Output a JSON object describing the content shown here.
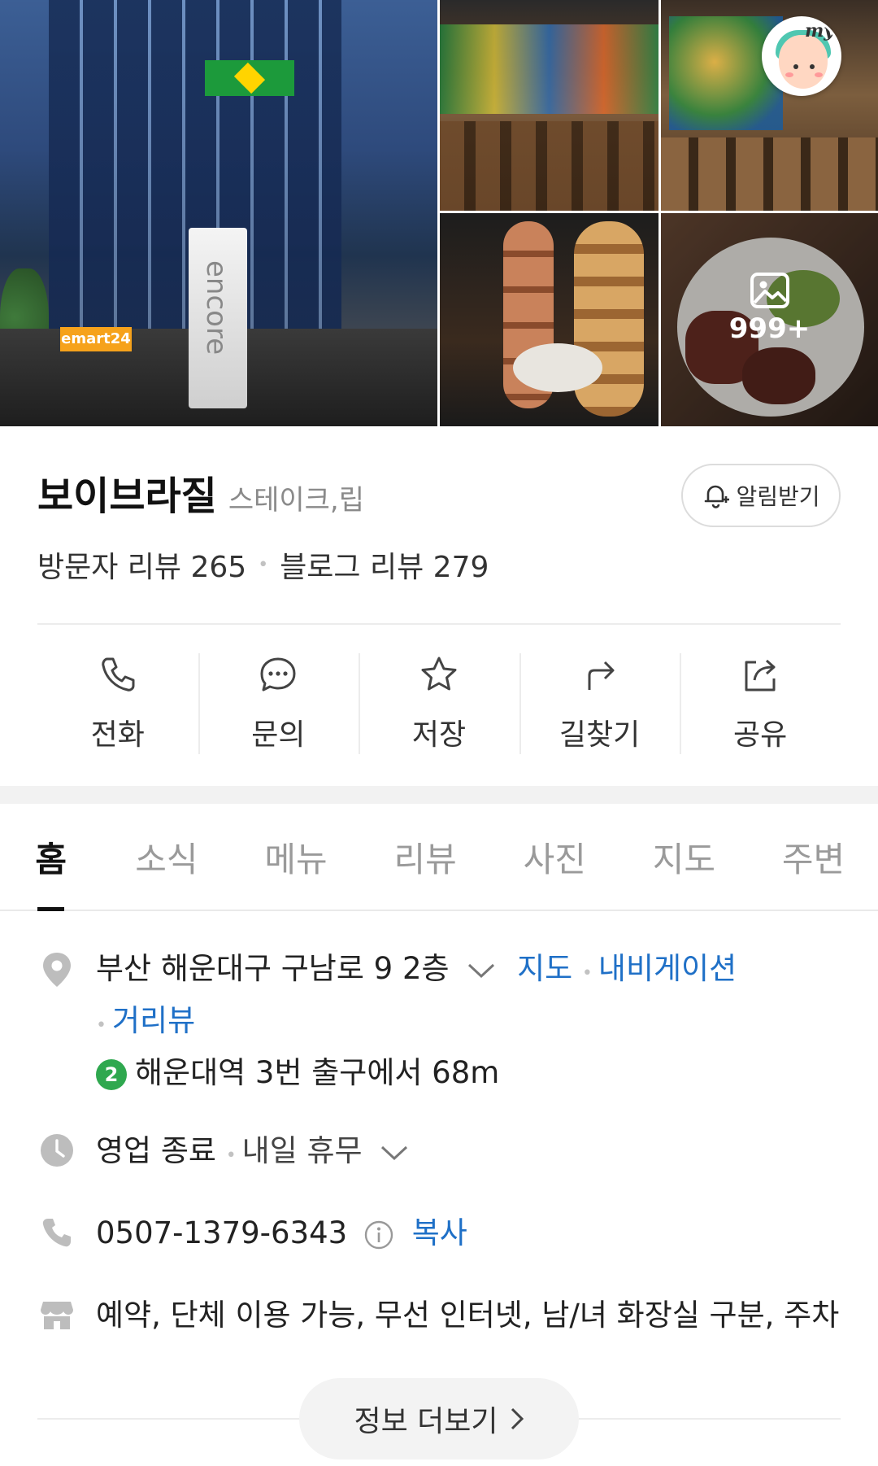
{
  "gallery": {
    "photo_count": "999+",
    "main_photo_sign": "encore",
    "main_photo_store": "emart24"
  },
  "profile": {
    "badge": "my"
  },
  "place": {
    "name": "보이브라질",
    "category": "스테이크,립",
    "alarm_label": "알림받기",
    "visitor_reviews": "방문자 리뷰 265",
    "blog_reviews": "블로그 리뷰 279"
  },
  "actions": [
    {
      "label": "전화",
      "icon": "phone-icon"
    },
    {
      "label": "문의",
      "icon": "chat-icon"
    },
    {
      "label": "저장",
      "icon": "star-icon"
    },
    {
      "label": "길찾기",
      "icon": "directions-icon"
    },
    {
      "label": "공유",
      "icon": "share-icon"
    }
  ],
  "tabs": [
    "홈",
    "소식",
    "메뉴",
    "리뷰",
    "사진",
    "지도",
    "주변"
  ],
  "info": {
    "address": "부산 해운대구 구남로 9 2층",
    "map_link": "지도",
    "nav_link": "내비게이션",
    "street_view_link": "거리뷰",
    "subway_line": "2",
    "subway_text": "해운대역 3번 출구에서 68m",
    "hours_status": "영업 종료",
    "hours_next": "내일 휴무",
    "phone": "0507-1379-6343",
    "copy_label": "복사",
    "amenities": "예약, 단체 이용 가능, 무선 인터넷, 남/녀 화장실 구분, 주차"
  },
  "more_info_label": "정보 더보기",
  "colors": {
    "link": "#1f70c7",
    "subway_line_2": "#2fa84f",
    "muted_text": "#8a8a8a"
  }
}
